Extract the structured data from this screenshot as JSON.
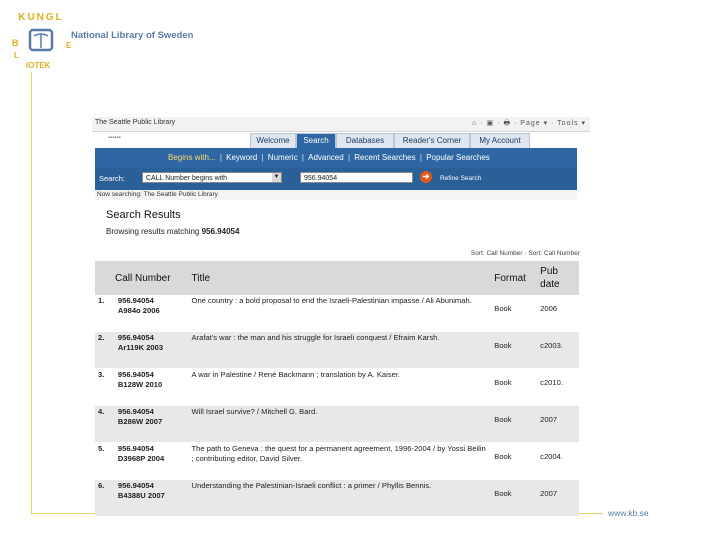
{
  "header": {
    "org_name": "National Library of Sweden",
    "logo_text": "KUNGL. BIBLIOTEKET"
  },
  "footer": {
    "url": "www.kb.se"
  },
  "browser": {
    "title": "The Seattle Public Library",
    "tools": "⌂ · ▣ · 🖶 · Page ▾ · Tools ▾"
  },
  "tabs": [
    {
      "label": "Welcome",
      "active": false
    },
    {
      "label": "Search",
      "active": true
    },
    {
      "label": "Databases",
      "active": false
    },
    {
      "label": "Reader's Corner",
      "active": false
    },
    {
      "label": "My Account",
      "active": false
    }
  ],
  "nav": {
    "links": [
      "Begins with...",
      "Keyword",
      "Numeric",
      "Advanced",
      "Recent Searches",
      "Popular Searches"
    ]
  },
  "search": {
    "label": "Search:",
    "type_value": "CALL Number begins with",
    "query_value": "956.94054",
    "refine": "Refine Search",
    "now_searching": "Now searching: The Seattle Public Library"
  },
  "results": {
    "heading": "Search Results",
    "browsing_prefix": "Browsing results matching",
    "browsing_query": "956.94054",
    "sort": "Sort: Call Number · Sort: Call Number",
    "columns": [
      "Call Number",
      "Title",
      "Format",
      "Pub date"
    ],
    "rows": [
      {
        "n": "1.",
        "call1": "956.94054",
        "call2": "A984o 2006",
        "title": "One country : a bold proposal to end the Israeli-Palestinian impasse / Ali Abunimah.",
        "format": "Book",
        "pub": "2006"
      },
      {
        "n": "2.",
        "call1": "956.94054",
        "call2": "Ar119K 2003",
        "title": "Arafat's war : the man and his struggle for Israeli conquest / Efraim Karsh.",
        "format": "Book",
        "pub": "c2003."
      },
      {
        "n": "3.",
        "call1": "956.94054",
        "call2": "B128W 2010",
        "title": "A war in Palestine / René Backmann ; translation by A. Kaiser.",
        "format": "Book",
        "pub": "c2010."
      },
      {
        "n": "4.",
        "call1": "956.94054",
        "call2": "B286W 2007",
        "title": "Will Israel survive? / Mitchell G. Bard.",
        "format": "Book",
        "pub": "2007"
      },
      {
        "n": "5.",
        "call1": "956.94054",
        "call2": "D3968P 2004",
        "title": "The path to Geneva : the quest for a permanent agreement, 1996-2004 / by Yossi Beilin ; contributing editor, David Silver.",
        "format": "Book",
        "pub": "c2004."
      },
      {
        "n": "6.",
        "call1": "956.94054",
        "call2": "B4388U 2007",
        "title": "Understanding the Palestinian-Israeli conflict : a primer / Phyllis Bennis.",
        "format": "Book",
        "pub": "2007"
      }
    ]
  }
}
